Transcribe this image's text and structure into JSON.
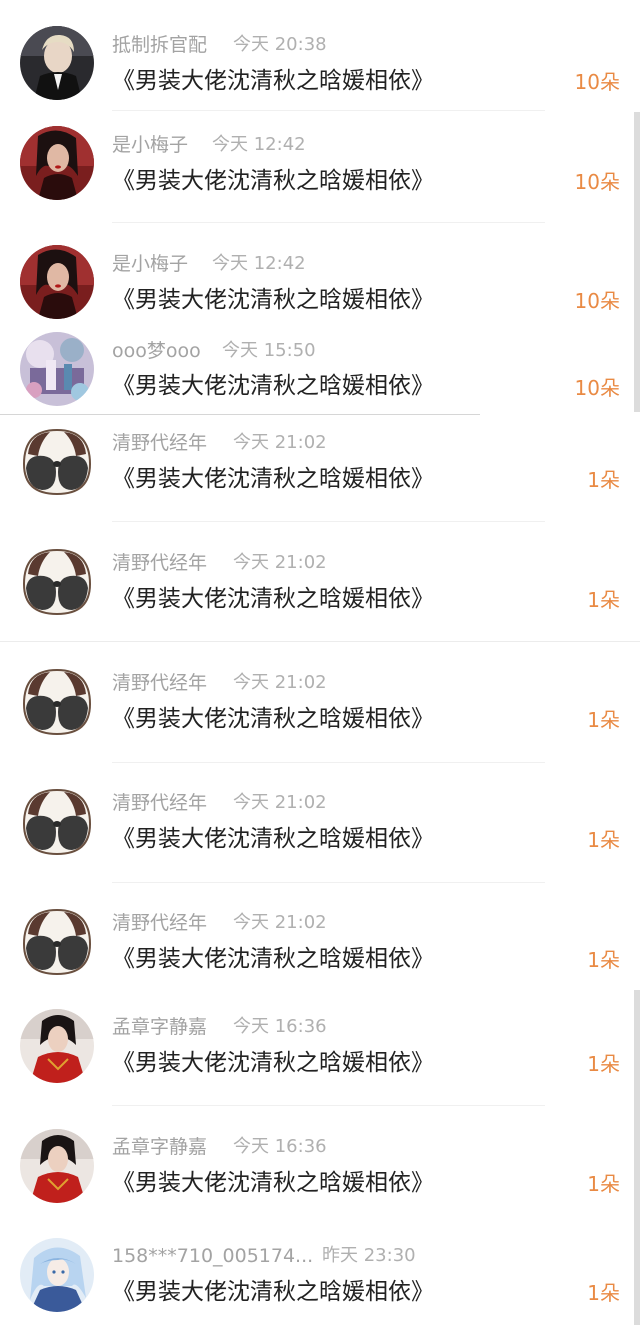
{
  "gifts": [
    {
      "username": "抵制拆官配",
      "time": "今天 20:38",
      "message": "《男装大佬沈清秋之晗媛相依》",
      "amount": "10朵",
      "avatar": "blond-man-avatar"
    },
    {
      "username": "是小梅子",
      "time": "今天 12:42",
      "message": "《男装大佬沈清秋之晗媛相依》",
      "amount": "10朵",
      "avatar": "red-woman-avatar"
    },
    {
      "username": "是小梅子",
      "time": "今天 12:42",
      "message": "《男装大佬沈清秋之晗媛相依》",
      "amount": "10朵",
      "avatar": "red-woman-avatar"
    },
    {
      "username": "ooo梦ooo",
      "time": "今天 15:50",
      "message": "《男装大佬沈清秋之晗媛相依》",
      "amount": "10朵",
      "avatar": "fantasy-scene-avatar"
    },
    {
      "username": "清野代经年",
      "time": "今天 21:02",
      "message": "《男装大佬沈清秋之晗媛相依》",
      "amount": "1朵",
      "avatar": "panda-avatar"
    },
    {
      "username": "清野代经年",
      "time": "今天 21:02",
      "message": "《男装大佬沈清秋之晗媛相依》",
      "amount": "1朵",
      "avatar": "panda-avatar"
    },
    {
      "username": "清野代经年",
      "time": "今天 21:02",
      "message": "《男装大佬沈清秋之晗媛相依》",
      "amount": "1朵",
      "avatar": "panda-avatar"
    },
    {
      "username": "清野代经年",
      "time": "今天 21:02",
      "message": "《男装大佬沈清秋之晗媛相依》",
      "amount": "1朵",
      "avatar": "panda-avatar"
    },
    {
      "username": "清野代经年",
      "time": "今天 21:02",
      "message": "《男装大佬沈清秋之晗媛相依》",
      "amount": "1朵",
      "avatar": "panda-avatar"
    },
    {
      "username": "孟章字静嘉",
      "time": "今天 16:36",
      "message": "《男装大佬沈清秋之晗媛相依》",
      "amount": "1朵",
      "avatar": "red-dress-avatar"
    },
    {
      "username": "孟章字静嘉",
      "time": "今天 16:36",
      "message": "《男装大佬沈清秋之晗媛相依》",
      "amount": "1朵",
      "avatar": "red-dress-avatar"
    },
    {
      "username": "158***710_005174...",
      "time": "昨天 23:30",
      "message": "《男装大佬沈清秋之晗媛相依》",
      "amount": "1朵",
      "avatar": "blue-anime-avatar"
    }
  ],
  "colors": {
    "amount": "#e98a44",
    "username": "#a3a3a3",
    "message": "#222222"
  }
}
